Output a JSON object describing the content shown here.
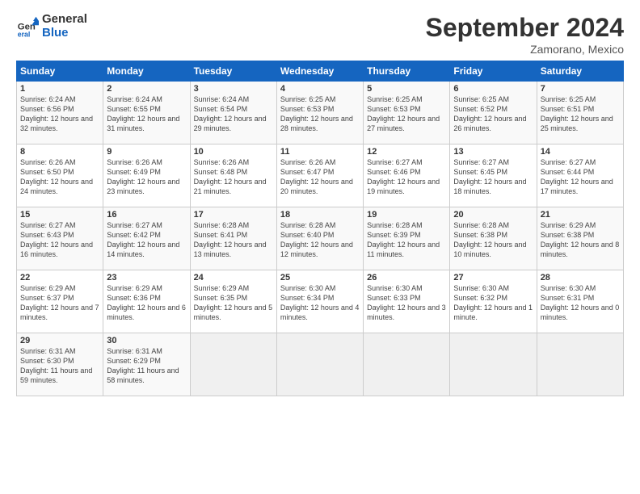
{
  "header": {
    "logo_general": "General",
    "logo_blue": "Blue",
    "title": "September 2024",
    "subtitle": "Zamorano, Mexico"
  },
  "days_of_week": [
    "Sunday",
    "Monday",
    "Tuesday",
    "Wednesday",
    "Thursday",
    "Friday",
    "Saturday"
  ],
  "weeks": [
    [
      {
        "day": "1",
        "sunrise": "6:24 AM",
        "sunset": "6:56 PM",
        "daylight": "12 hours and 32 minutes."
      },
      {
        "day": "2",
        "sunrise": "6:24 AM",
        "sunset": "6:55 PM",
        "daylight": "12 hours and 31 minutes."
      },
      {
        "day": "3",
        "sunrise": "6:24 AM",
        "sunset": "6:54 PM",
        "daylight": "12 hours and 29 minutes."
      },
      {
        "day": "4",
        "sunrise": "6:25 AM",
        "sunset": "6:53 PM",
        "daylight": "12 hours and 28 minutes."
      },
      {
        "day": "5",
        "sunrise": "6:25 AM",
        "sunset": "6:53 PM",
        "daylight": "12 hours and 27 minutes."
      },
      {
        "day": "6",
        "sunrise": "6:25 AM",
        "sunset": "6:52 PM",
        "daylight": "12 hours and 26 minutes."
      },
      {
        "day": "7",
        "sunrise": "6:25 AM",
        "sunset": "6:51 PM",
        "daylight": "12 hours and 25 minutes."
      }
    ],
    [
      {
        "day": "8",
        "sunrise": "6:26 AM",
        "sunset": "6:50 PM",
        "daylight": "12 hours and 24 minutes."
      },
      {
        "day": "9",
        "sunrise": "6:26 AM",
        "sunset": "6:49 PM",
        "daylight": "12 hours and 23 minutes."
      },
      {
        "day": "10",
        "sunrise": "6:26 AM",
        "sunset": "6:48 PM",
        "daylight": "12 hours and 21 minutes."
      },
      {
        "day": "11",
        "sunrise": "6:26 AM",
        "sunset": "6:47 PM",
        "daylight": "12 hours and 20 minutes."
      },
      {
        "day": "12",
        "sunrise": "6:27 AM",
        "sunset": "6:46 PM",
        "daylight": "12 hours and 19 minutes."
      },
      {
        "day": "13",
        "sunrise": "6:27 AM",
        "sunset": "6:45 PM",
        "daylight": "12 hours and 18 minutes."
      },
      {
        "day": "14",
        "sunrise": "6:27 AM",
        "sunset": "6:44 PM",
        "daylight": "12 hours and 17 minutes."
      }
    ],
    [
      {
        "day": "15",
        "sunrise": "6:27 AM",
        "sunset": "6:43 PM",
        "daylight": "12 hours and 16 minutes."
      },
      {
        "day": "16",
        "sunrise": "6:27 AM",
        "sunset": "6:42 PM",
        "daylight": "12 hours and 14 minutes."
      },
      {
        "day": "17",
        "sunrise": "6:28 AM",
        "sunset": "6:41 PM",
        "daylight": "12 hours and 13 minutes."
      },
      {
        "day": "18",
        "sunrise": "6:28 AM",
        "sunset": "6:40 PM",
        "daylight": "12 hours and 12 minutes."
      },
      {
        "day": "19",
        "sunrise": "6:28 AM",
        "sunset": "6:39 PM",
        "daylight": "12 hours and 11 minutes."
      },
      {
        "day": "20",
        "sunrise": "6:28 AM",
        "sunset": "6:38 PM",
        "daylight": "12 hours and 10 minutes."
      },
      {
        "day": "21",
        "sunrise": "6:29 AM",
        "sunset": "6:38 PM",
        "daylight": "12 hours and 8 minutes."
      }
    ],
    [
      {
        "day": "22",
        "sunrise": "6:29 AM",
        "sunset": "6:37 PM",
        "daylight": "12 hours and 7 minutes."
      },
      {
        "day": "23",
        "sunrise": "6:29 AM",
        "sunset": "6:36 PM",
        "daylight": "12 hours and 6 minutes."
      },
      {
        "day": "24",
        "sunrise": "6:29 AM",
        "sunset": "6:35 PM",
        "daylight": "12 hours and 5 minutes."
      },
      {
        "day": "25",
        "sunrise": "6:30 AM",
        "sunset": "6:34 PM",
        "daylight": "12 hours and 4 minutes."
      },
      {
        "day": "26",
        "sunrise": "6:30 AM",
        "sunset": "6:33 PM",
        "daylight": "12 hours and 3 minutes."
      },
      {
        "day": "27",
        "sunrise": "6:30 AM",
        "sunset": "6:32 PM",
        "daylight": "12 hours and 1 minute."
      },
      {
        "day": "28",
        "sunrise": "6:30 AM",
        "sunset": "6:31 PM",
        "daylight": "12 hours and 0 minutes."
      }
    ],
    [
      {
        "day": "29",
        "sunrise": "6:31 AM",
        "sunset": "6:30 PM",
        "daylight": "11 hours and 59 minutes."
      },
      {
        "day": "30",
        "sunrise": "6:31 AM",
        "sunset": "6:29 PM",
        "daylight": "11 hours and 58 minutes."
      },
      null,
      null,
      null,
      null,
      null
    ]
  ]
}
